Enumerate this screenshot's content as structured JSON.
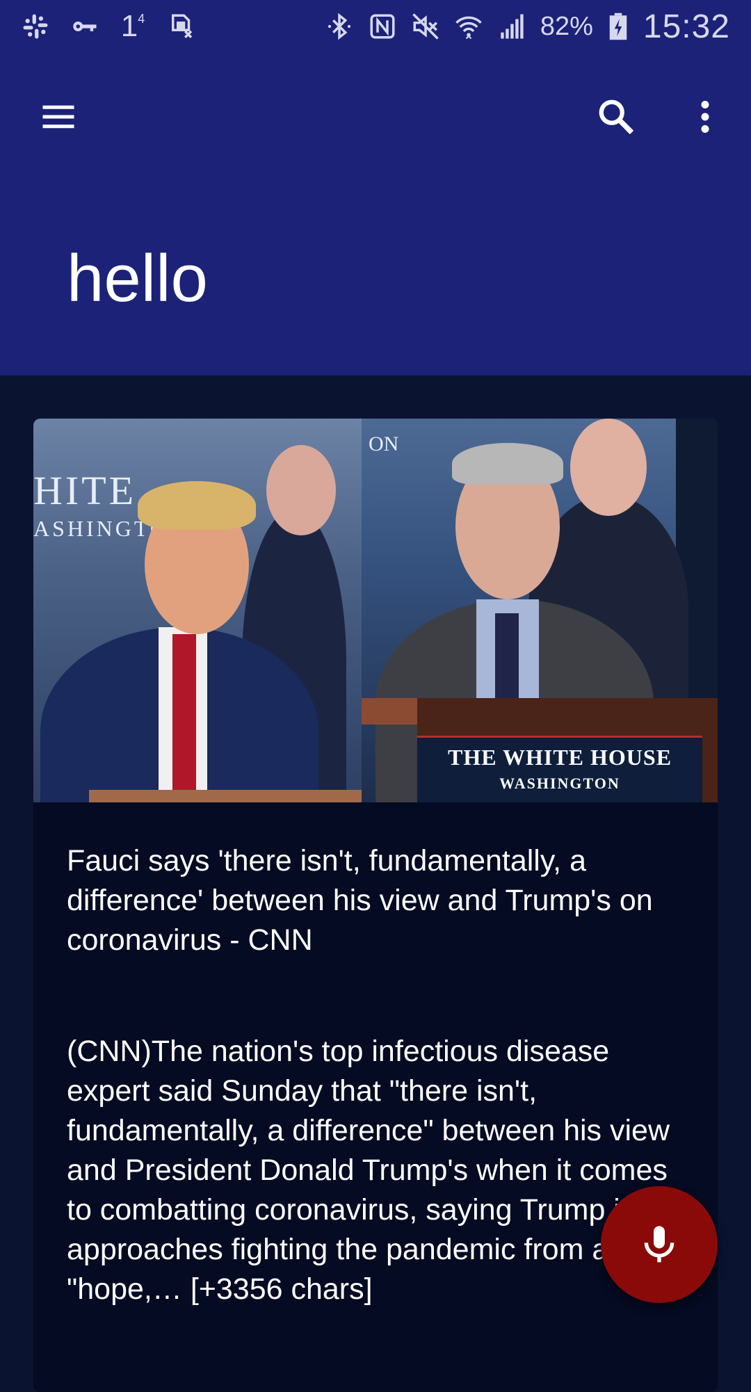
{
  "status_bar": {
    "battery_pct": "82%",
    "time": "15:32",
    "notification_icons": [
      "slack-icon",
      "vpn-key-icon",
      "one-icon",
      "sim-blocked-icon"
    ],
    "system_icons": [
      "bluetooth-icon",
      "nfc-icon",
      "mute-icon",
      "wifi-icon",
      "signal-icon",
      "battery-charging-icon"
    ],
    "badge_digit": "4"
  },
  "app_bar": {
    "title": "hello",
    "icons": [
      "menu-icon",
      "search-icon",
      "more-vert-icon"
    ]
  },
  "article": {
    "image_text_left_line1": "HITE",
    "image_text_left_line2": "ASHINGTO",
    "image_text_right_top": "ON",
    "podium_sign_title": "THE WHITE HOUSE",
    "podium_sign_sub": "WASHINGTON",
    "headline": "Fauci says 'there isn't, fundamentally, a difference' between his view and Trump's on coronavirus - CNN",
    "body": "(CNN)The nation's top infectious disease expert said Sunday that \"there isn't, fundamentally, a difference\" between his view and President Donald Trump's when it comes to combatting coronavirus, saying Trump just approaches fighting the pandemic from a \"hope,… [+3356 chars]"
  },
  "fab": {
    "icon": "mic-icon"
  },
  "colors": {
    "primary": "#1c2278",
    "background": "#0a1330",
    "card": "#040b22",
    "fab": "#8a0a0a"
  }
}
